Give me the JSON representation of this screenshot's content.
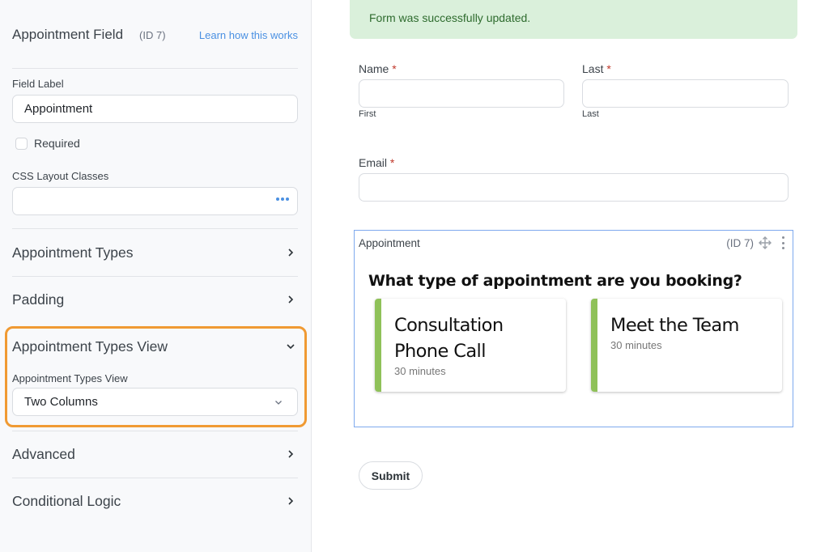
{
  "sidebar": {
    "title": "Appointment Field",
    "id_label": "(ID 7)",
    "learn_link": "Learn how this works",
    "field_label": {
      "label": "Field Label",
      "value": "Appointment"
    },
    "required": {
      "label": "Required",
      "checked": false
    },
    "css_classes": {
      "label": "CSS Layout Classes",
      "value": "",
      "more_icon": "ellipsis-icon"
    },
    "sections": [
      {
        "title": "Appointment Types",
        "icon": "chevron-right-icon",
        "expanded": false
      },
      {
        "title": "Padding",
        "icon": "chevron-right-icon",
        "expanded": false
      },
      {
        "title": "Appointment Types View",
        "icon": "chevron-down-icon",
        "expanded": true,
        "field_label": "Appointment Types View",
        "selected": "Two Columns"
      },
      {
        "title": "Advanced",
        "icon": "chevron-right-icon",
        "expanded": false
      },
      {
        "title": "Conditional Logic",
        "icon": "chevron-right-icon",
        "expanded": false
      }
    ],
    "highlight_color": "#f09a33"
  },
  "main": {
    "success_message": "Form was successfully updated.",
    "fields": {
      "name": {
        "label": "Name",
        "required_mark": "*",
        "sublabel": "First",
        "value": ""
      },
      "last": {
        "label": "Last",
        "required_mark": "*",
        "sublabel": "Last",
        "value": ""
      },
      "email": {
        "label": "Email",
        "required_mark": "*",
        "value": ""
      }
    },
    "appointment": {
      "label": "Appointment",
      "id_label": "(ID 7)",
      "question": "What type of appointment are you booking?",
      "types": [
        {
          "title": "Consultation Phone Call",
          "duration": "30 minutes"
        },
        {
          "title": "Meet the Team",
          "duration": "30 minutes"
        }
      ],
      "accent_color": "#8fc159"
    },
    "submit_label": "Submit"
  }
}
